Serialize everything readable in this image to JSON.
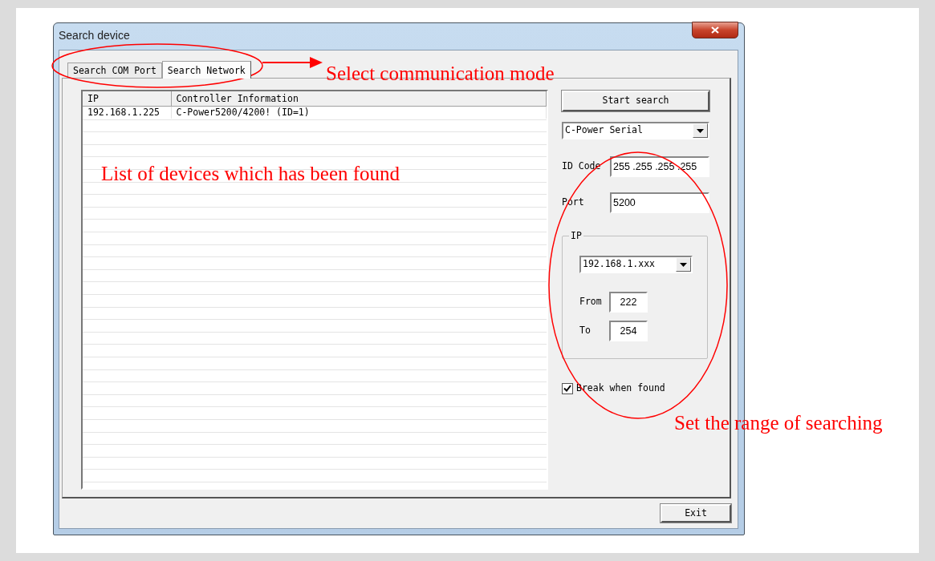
{
  "window": {
    "title": "Search device"
  },
  "tabs": [
    {
      "label": "Search COM Port",
      "selected": false
    },
    {
      "label": "Search Network",
      "selected": true
    }
  ],
  "table": {
    "columns": [
      "IP",
      "Controller Information"
    ],
    "rows": [
      [
        "192.168.1.225",
        "C-Power5200/4200!  (ID=1)"
      ]
    ]
  },
  "start_button": "Start search",
  "protocol_select": {
    "value": "C-Power Serial"
  },
  "id_code": {
    "label": "ID Code",
    "value": "255 .255 .255 .255"
  },
  "port": {
    "label": "Port",
    "value": "5200"
  },
  "ip_group": {
    "title": "IP",
    "subnet": "192.168.1.xxx",
    "from": {
      "label": "From",
      "value": "222"
    },
    "to": {
      "label": "To",
      "value": "254"
    }
  },
  "break_when_found": {
    "label": "Break when found",
    "checked": true
  },
  "exit_button": "Exit",
  "annotations": [
    {
      "text": "Select communication mode"
    },
    {
      "text": "List of devices which has been found"
    },
    {
      "text": "Set the range of searching"
    }
  ]
}
